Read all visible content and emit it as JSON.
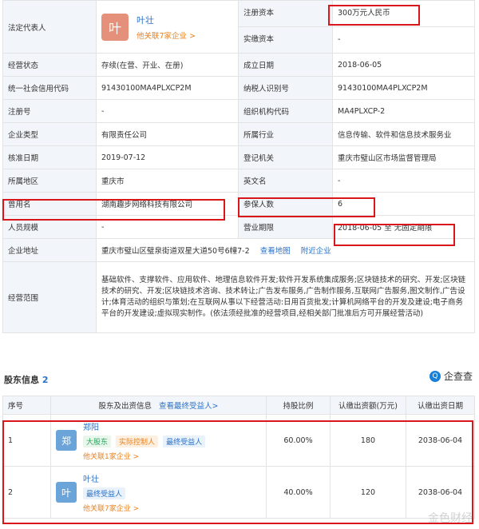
{
  "legal_rep": {
    "label": "法定代表人",
    "avatar": "叶",
    "name": "叶壮",
    "link": "他关联7家企业 >"
  },
  "rows": {
    "reg_capital": {
      "label": "注册资本",
      "value": "300万元人民币"
    },
    "paid_capital": {
      "label": "实缴资本",
      "value": "-"
    },
    "status": {
      "label": "经营状态",
      "value": "存续(在营、开业、在册)"
    },
    "founded": {
      "label": "成立日期",
      "value": "2018-06-05"
    },
    "credit_code": {
      "label": "统一社会信用代码",
      "value": "91430100MA4PLXCP2M"
    },
    "taxpayer_id": {
      "label": "纳税人识别号",
      "value": "91430100MA4PLXCP2M"
    },
    "reg_no": {
      "label": "注册号",
      "value": "-"
    },
    "org_code": {
      "label": "组织机构代码",
      "value": "MA4PLXCP-2"
    },
    "company_type": {
      "label": "企业类型",
      "value": "有限责任公司"
    },
    "industry": {
      "label": "所属行业",
      "value": "信息传输、软件和信息技术服务业"
    },
    "approval_date": {
      "label": "核准日期",
      "value": "2019-07-12"
    },
    "authority": {
      "label": "登记机关",
      "value": "重庆市璧山区市场监督管理局"
    },
    "region": {
      "label": "所属地区",
      "value": "重庆市"
    },
    "english_name": {
      "label": "英文名",
      "value": "-"
    },
    "former_name": {
      "label": "曾用名",
      "value": "湖南趣步网络科技有限公司"
    },
    "insured": {
      "label": "参保人数",
      "value": "6"
    },
    "staff_size": {
      "label": "人员规模",
      "value": "-"
    },
    "business_term": {
      "label": "营业期限",
      "value": "2018-06-05 至 无固定期限"
    },
    "address": {
      "label": "企业地址",
      "value": "重庆市璧山区璧泉街道双星大道50号6幢7-2",
      "map_link": "查看地图",
      "nearby_link": "附近企业"
    },
    "scope": {
      "label": "经营范围",
      "value": "基础软件、支撑软件、应用软件、地理信息软件开发;软件开发系统集成服务;区块链技术的研究、开发;区块链技术的研究、开发;区块链技术咨询、技术转让;广告发布服务,广告制作服务,互联网广告服务,图文制作,广告设计;体育活动的组织与策划;在互联网从事以下经营活动:日用百货批发;计算机网络平台的开发及建设;电子商务平台的开发建设;虚拟现实制作。(依法须经批准的经营项目,经相关部门批准后方可开展经营活动)"
    }
  },
  "shareholders": {
    "title": "股东信息",
    "count": "2",
    "brand": "企查查",
    "brand_icon": "Q",
    "headers": {
      "no": "序号",
      "holder": "股东及出资信息",
      "beneficiary_link": "查看最终受益人>",
      "ratio": "持股比例",
      "subscribed": "认缴出资额(万元)",
      "date": "认缴出资日期"
    },
    "items": [
      {
        "no": "1",
        "avatar": "郑",
        "name": "郑阳",
        "tags": [
          "大股东",
          "实际控制人",
          "最终受益人"
        ],
        "link": "他关联1家企业 >",
        "ratio": "60.00%",
        "amount": "180",
        "date": "2038-06-04"
      },
      {
        "no": "2",
        "avatar": "叶",
        "name": "叶壮",
        "tags": [
          "最终受益人"
        ],
        "link": "他关联7家企业 >",
        "ratio": "40.00%",
        "amount": "120",
        "date": "2038-06-04"
      }
    ]
  },
  "watermark": "金色财经"
}
